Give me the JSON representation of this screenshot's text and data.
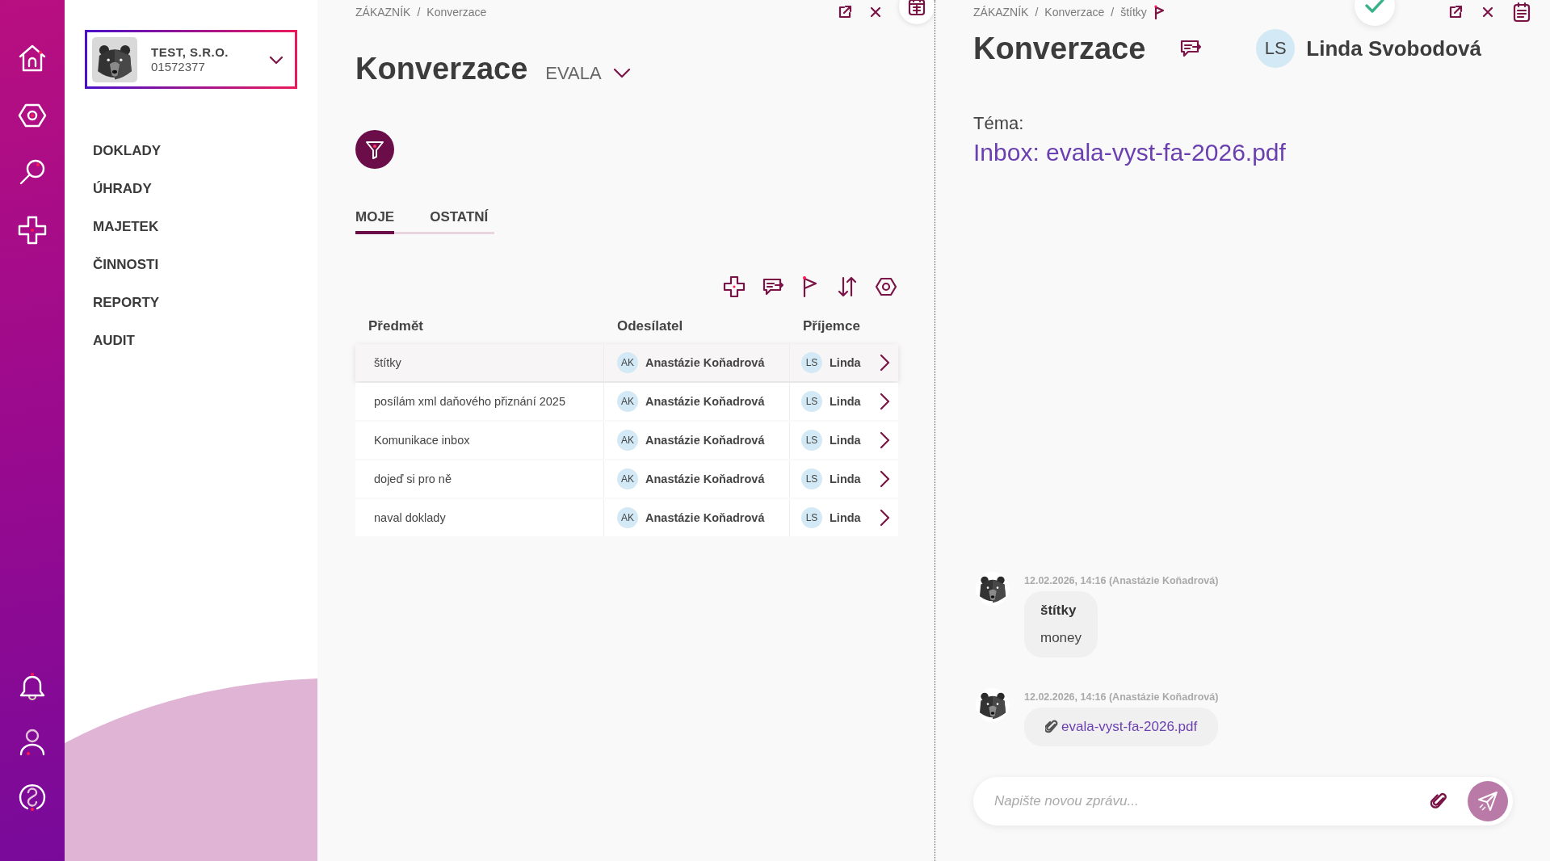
{
  "company": {
    "name": "TEST, S.R.O.",
    "number": "01572377"
  },
  "nav": [
    "DOKLADY",
    "ÚHRADY",
    "MAJETEK",
    "ČINNOSTI",
    "REPORTY",
    "AUDIT"
  ],
  "list_panel": {
    "breadcrumb": [
      "ZÁKAZNÍK",
      "Konverzace"
    ],
    "separator": "/",
    "title": "Konverzace",
    "scope": "EVALA",
    "tabs": [
      {
        "label": "MOJE",
        "selected": true
      },
      {
        "label": "OSTATNÍ",
        "selected": false
      }
    ],
    "table": {
      "columns": [
        "Předmět",
        "Odesílatel",
        "Příjemce"
      ],
      "rows": [
        {
          "subject": "štítky",
          "sender": {
            "initials": "AK",
            "name": "Anastázie Koňadrová"
          },
          "recipient": {
            "initials": "LS",
            "name": "Linda"
          },
          "selected": true
        },
        {
          "subject": "posílám xml daňového přiznání 2025",
          "sender": {
            "initials": "AK",
            "name": "Anastázie Koňadrová"
          },
          "recipient": {
            "initials": "LS",
            "name": "Linda"
          },
          "selected": false
        },
        {
          "subject": "Komunikace inbox",
          "sender": {
            "initials": "AK",
            "name": "Anastázie Koňadrová"
          },
          "recipient": {
            "initials": "LS",
            "name": "Linda"
          },
          "selected": false
        },
        {
          "subject": "dojeď si pro ně",
          "sender": {
            "initials": "AK",
            "name": "Anastázie Koňadrová"
          },
          "recipient": {
            "initials": "LS",
            "name": "Linda"
          },
          "selected": false
        },
        {
          "subject": "naval doklady",
          "sender": {
            "initials": "AK",
            "name": "Anastázie Koňadrová"
          },
          "recipient": {
            "initials": "LS",
            "name": "Linda"
          },
          "selected": false
        }
      ]
    }
  },
  "detail": {
    "breadcrumb": [
      "ZÁKAZNÍK",
      "Konverzace",
      "štítky"
    ],
    "separator": "/",
    "title": "Konverzace",
    "assignee": {
      "initials": "LS",
      "name": "Linda Svobodová"
    },
    "topic_label": "Téma:",
    "topic": "Inbox: evala-vyst-fa-2026.pdf",
    "messages": [
      {
        "kind": "text",
        "meta": "12.02.2026, 14:16 (Anastázie Koňadrová)",
        "title": "štítky",
        "body": "money"
      },
      {
        "kind": "attachment",
        "meta": "12.02.2026, 14:16 (Anastázie Koňadrová)",
        "file": "evala-vyst-fa-2026.pdf"
      }
    ],
    "composer": {
      "placeholder": "Napište novou zprávu..."
    }
  }
}
